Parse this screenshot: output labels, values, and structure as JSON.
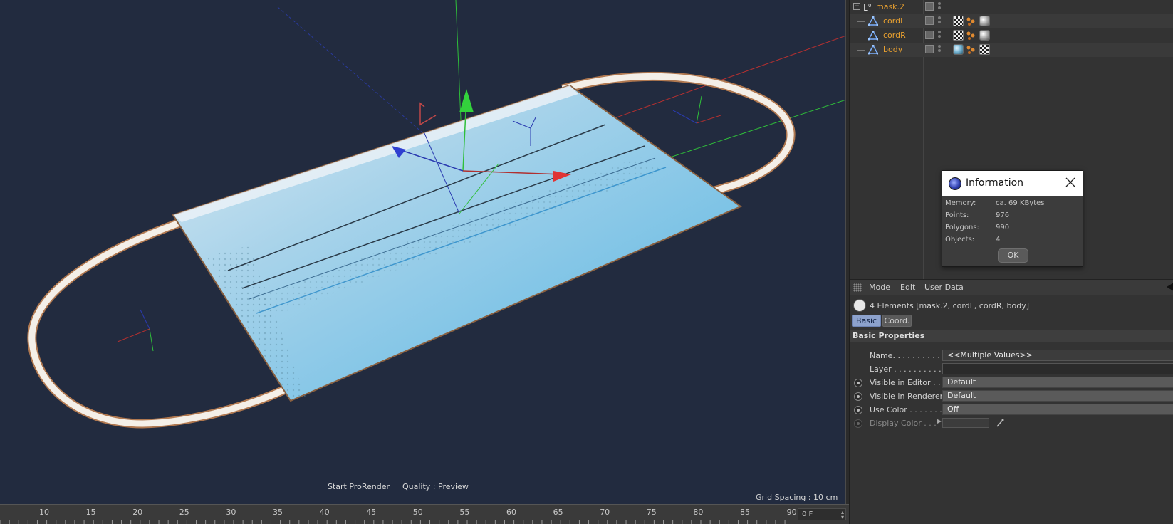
{
  "viewport": {
    "hud_start_prorender": "Start ProRender",
    "hud_quality": "Quality : Preview",
    "grid_spacing": "Grid Spacing : 10 cm",
    "background_color": "#222b3f"
  },
  "timeline": {
    "ticks": [
      "10",
      "15",
      "20",
      "25",
      "30",
      "35",
      "40",
      "45",
      "50",
      "55",
      "60",
      "65",
      "70",
      "75",
      "80",
      "85",
      "90"
    ],
    "current_frame": "0 F"
  },
  "objects": {
    "items": [
      {
        "name": "mask.2",
        "kind": "null-icon",
        "tags": []
      },
      {
        "name": "cordL",
        "kind": "polygon-icon",
        "tags": [
          "checker-material-tag",
          "phong-tag",
          "sphere-material-tag"
        ]
      },
      {
        "name": "cordR",
        "kind": "polygon-icon",
        "tags": [
          "checker-material-tag",
          "phong-tag",
          "sphere-material-tag"
        ]
      },
      {
        "name": "body",
        "kind": "polygon-icon",
        "tags": [
          "blue-material-tag",
          "phong-tag",
          "checker-material-tag"
        ]
      }
    ],
    "name_color": "#e8a030"
  },
  "info_dialog": {
    "title": "Information",
    "rows": [
      {
        "key": "Memory:",
        "value": "ca. 69 KBytes"
      },
      {
        "key": "Points:",
        "value": "976"
      },
      {
        "key": "Polygons:",
        "value": "990"
      },
      {
        "key": "Objects:",
        "value": "4"
      }
    ],
    "ok_label": "OK"
  },
  "attributes": {
    "menu": [
      "Mode",
      "Edit",
      "User Data"
    ],
    "elements_text": "4 Elements [mask.2, cordL, cordR, body]",
    "tabs": [
      "Basic",
      "Coord."
    ],
    "section_title": "Basic Properties",
    "props": {
      "name_label": "Name. . . . . . . . . . . .",
      "name_value": "<<Multiple Values>>",
      "layer_label": "Layer . . . . . . . . . . . .",
      "layer_value": "",
      "visible_editor_label": "Visible in Editor . . .",
      "visible_editor_value": "Default",
      "visible_renderer_label": "Visible in Renderer",
      "visible_renderer_value": "Default",
      "use_color_label": "Use Color . . . . . . . .",
      "use_color_value": "Off",
      "display_color_label": "Display Color . . ."
    },
    "active_tab_color": "#8da2cc"
  }
}
